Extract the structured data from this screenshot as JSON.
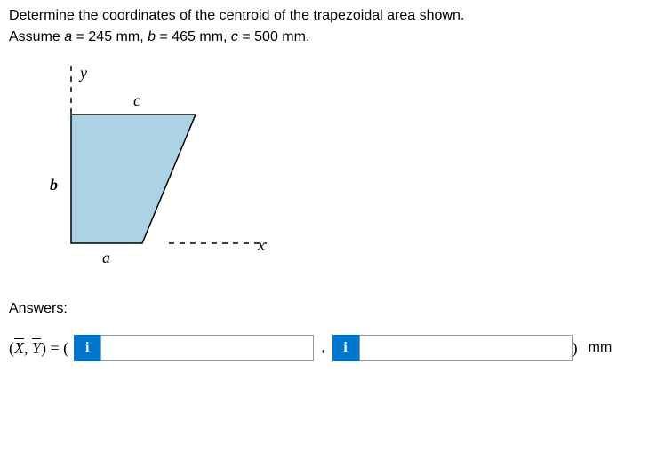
{
  "question": {
    "line1": "Determine the coordinates of the centroid of the trapezoidal area shown.",
    "line2_prefix": "Assume ",
    "a_var": "a",
    "a_eq": " = 245 mm, ",
    "b_var": "b",
    "b_eq": " = 465 mm, ",
    "c_var": "c",
    "c_eq": " = 500 mm."
  },
  "figure": {
    "y_label": "y",
    "x_label": "x",
    "a_label": "a",
    "b_label": "b",
    "c_label": "c"
  },
  "answers": {
    "label": "Answers:",
    "formula_open": "(",
    "x_sym": "X",
    "comma_sym": ", ",
    "y_sym": "Y",
    "formula_close": ")",
    "equals": " = ( ",
    "info_icon": "i",
    "separator": ",",
    "close_paren": " ) ",
    "unit": "mm",
    "input1_value": "",
    "input2_value": ""
  }
}
